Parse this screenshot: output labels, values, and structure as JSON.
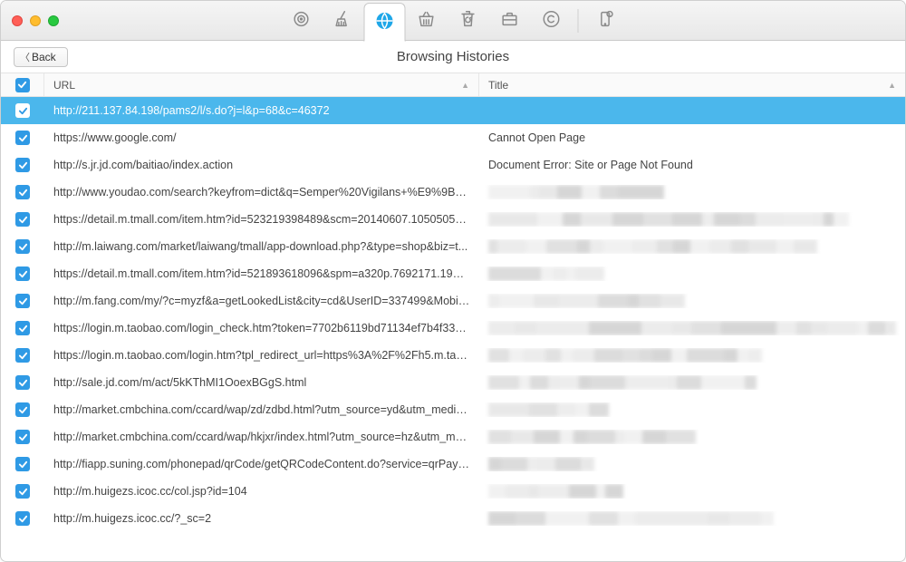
{
  "header": {
    "back_label": "Back",
    "page_title": "Browsing Histories"
  },
  "toolbar_tabs": [
    {
      "icon": "target"
    },
    {
      "icon": "broom"
    },
    {
      "icon": "globe",
      "active": true
    },
    {
      "icon": "basket"
    },
    {
      "icon": "recycle"
    },
    {
      "icon": "briefcase"
    },
    {
      "icon": "copyright"
    },
    {
      "icon": "phone-badge"
    }
  ],
  "columns": {
    "url_label": "URL",
    "title_label": "Title"
  },
  "master_checked": true,
  "rows": [
    {
      "checked": true,
      "selected": true,
      "url": "http://211.137.84.198/pams2/l/s.do?j=l&p=68&c=46372",
      "title": ""
    },
    {
      "checked": true,
      "url": "https://www.google.com/",
      "title": "Cannot Open Page"
    },
    {
      "checked": true,
      "url": "http://s.jr.jd.com/baitiao/index.action",
      "title": "Document Error: Site or Page Not Found"
    },
    {
      "checked": true,
      "url": "http://www.youdao.com/search?keyfrom=dict&q=Semper%20Vigilans+%E9%9B%...",
      "title_blur": true
    },
    {
      "checked": true,
      "url": "https://detail.m.tmall.com/item.htm?id=523219398489&scm=20140607.105050564...",
      "title_blur": true
    },
    {
      "checked": true,
      "url": "http://m.laiwang.com/market/laiwang/tmall/app-download.php?&type=shop&biz=t...",
      "title_blur": true
    },
    {
      "checked": true,
      "url": "https://detail.m.tmall.com/item.htm?id=521893618096&spm=a320p.7692171.1998...",
      "title_blur": true
    },
    {
      "checked": true,
      "url": "http://m.fang.com/my/?c=myzf&a=getLookedList&city=cd&UserID=337499&Mobile...",
      "title_blur": true
    },
    {
      "checked": true,
      "url": "https://login.m.taobao.com/login_check.htm?token=7702b6119bd71134ef7b4f339...",
      "title_blur": true
    },
    {
      "checked": true,
      "url": "https://login.m.taobao.com/login.htm?tpl_redirect_url=https%3A%2F%2Fh5.m.tao...",
      "title_blur": true
    },
    {
      "checked": true,
      "url": "http://sale.jd.com/m/act/5kKThMI1OoexBGgS.html",
      "title_blur": true
    },
    {
      "checked": true,
      "url": "http://market.cmbchina.com/ccard/wap/zd/zdbd.html?utm_source=yd&utm_mediu...",
      "title_blur": true
    },
    {
      "checked": true,
      "url": "http://market.cmbchina.com/ccard/wap/hkjxr/index.html?utm_source=hz&utm_me...",
      "title_blur": true
    },
    {
      "checked": true,
      "url": "http://fiapp.suning.com/phonepad/qrCode/getQRCodeContent.do?service=qrPayB...",
      "title_blur": true
    },
    {
      "checked": true,
      "url": "http://m.huigezs.icoc.cc/col.jsp?id=104",
      "title_blur": true
    },
    {
      "checked": true,
      "url": "http://m.huigezs.icoc.cc/?_sc=2",
      "title_blur": true
    }
  ]
}
